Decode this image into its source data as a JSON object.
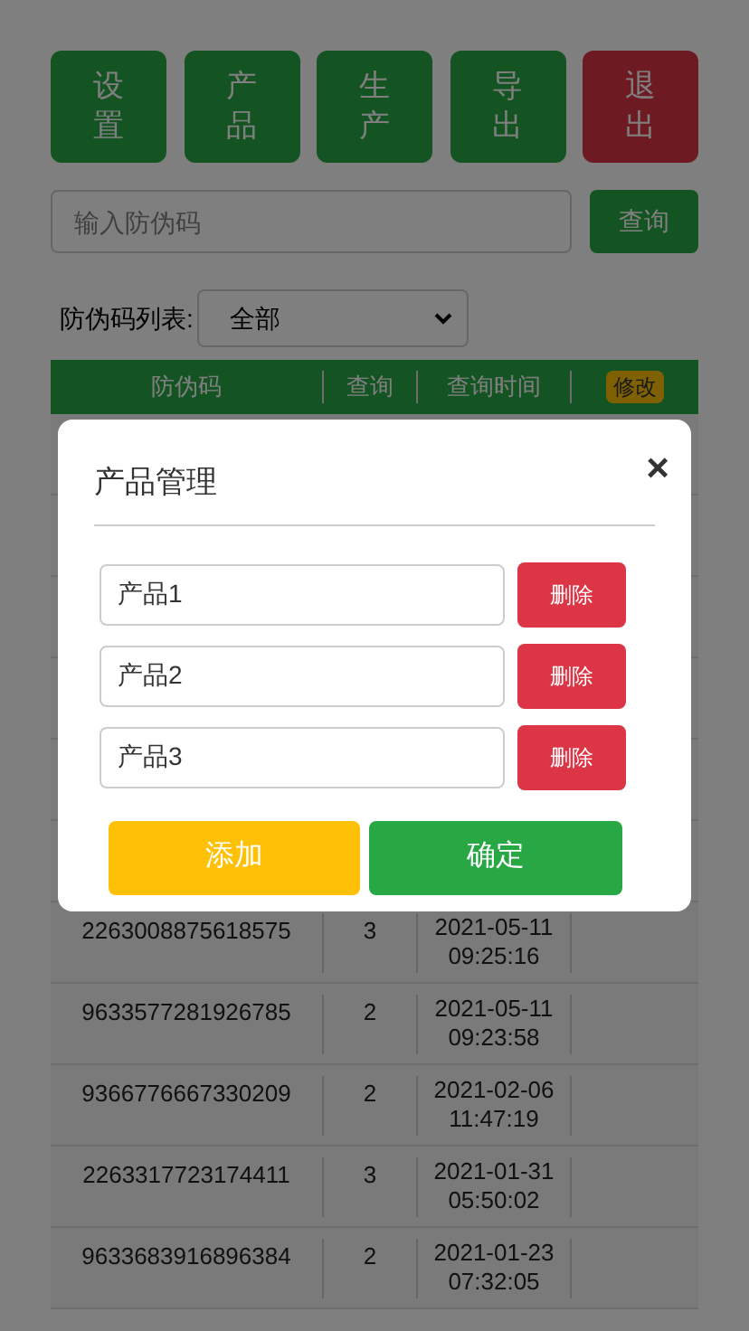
{
  "nav_buttons": [
    {
      "label": "设置",
      "kind": "normal"
    },
    {
      "label": "产品",
      "kind": "normal"
    },
    {
      "label": "生产",
      "kind": "normal"
    },
    {
      "label": "导出",
      "kind": "normal"
    },
    {
      "label": "退出",
      "kind": "danger"
    }
  ],
  "search": {
    "placeholder": "输入防伪码",
    "button": "查询"
  },
  "filter": {
    "label": "防伪码列表:",
    "value": "全部"
  },
  "table": {
    "columns": [
      "防伪码",
      "查询",
      "查询时间",
      "修改"
    ],
    "rows": [
      {
        "code": "2263008875618575",
        "count": "3",
        "date": "2021-05-11",
        "time": "09:25:16"
      },
      {
        "code": "9633577281926785",
        "count": "2",
        "date": "2021-05-11",
        "time": "09:23:58"
      },
      {
        "code": "9366776667330209",
        "count": "2",
        "date": "2021-02-06",
        "time": "11:47:19"
      },
      {
        "code": "2263317723174411",
        "count": "3",
        "date": "2021-01-31",
        "time": "05:50:02"
      },
      {
        "code": "9633683916896384",
        "count": "2",
        "date": "2021-01-23",
        "time": "07:32:05"
      }
    ]
  },
  "modal": {
    "title": "产品管理",
    "close": "×",
    "products": [
      {
        "value": "产品1",
        "delete": "删除"
      },
      {
        "value": "产品2",
        "delete": "删除"
      },
      {
        "value": "产品3",
        "delete": "删除"
      }
    ],
    "add_button": "添加",
    "confirm_button": "确定"
  }
}
